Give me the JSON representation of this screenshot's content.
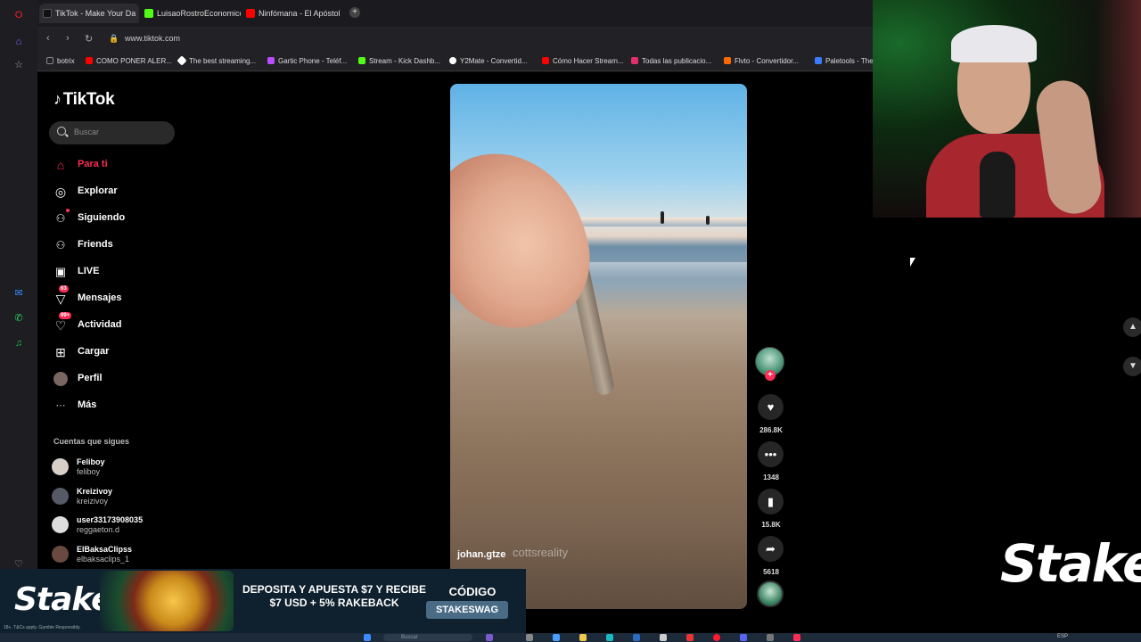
{
  "browser": {
    "tabs": [
      {
        "label": "TikTok - Make Your Da",
        "active": true,
        "color": "#000000"
      },
      {
        "label": "LuisaoRostroEconomico S",
        "active": false,
        "color": "#53fc18"
      },
      {
        "label": "Ninfómana - El Apóstol ft.",
        "active": false,
        "color": "#ff0000"
      }
    ],
    "new_tab_label": "+",
    "url": "www.tiktok.com",
    "bookmarks": [
      {
        "label": "botrix",
        "color": "#777777"
      },
      {
        "label": "COMO PONER ALER...",
        "color": "#ff0000"
      },
      {
        "label": "The best streaming...",
        "color": "#ffffff"
      },
      {
        "label": "Gartic Phone - Teléf...",
        "color": "#b94cff"
      },
      {
        "label": "Stream - Kick Dashb...",
        "color": "#53fc18"
      },
      {
        "label": "Y2Mate - Convertid...",
        "color": "#ffffff"
      },
      {
        "label": "Cómo Hacer Stream...",
        "color": "#ff0000"
      },
      {
        "label": "Todas las publicacio...",
        "color": "#e1306c"
      },
      {
        "label": "Flvto - Convertidor...",
        "color": "#ff6a00"
      },
      {
        "label": "Paletools - The",
        "color": "#3a7bff"
      }
    ]
  },
  "tiktok": {
    "logo": "TikTok",
    "search_placeholder": "Buscar",
    "nav": [
      {
        "label": "Para ti",
        "icon": "home-icon",
        "glyph": "⌂",
        "active": true
      },
      {
        "label": "Explorar",
        "icon": "compass-icon",
        "glyph": "◎"
      },
      {
        "label": "Siguiendo",
        "icon": "following-icon",
        "glyph": "👤"
      },
      {
        "label": "Friends",
        "icon": "friends-icon",
        "glyph": "👥"
      },
      {
        "label": "LIVE",
        "icon": "live-icon",
        "glyph": "▣"
      },
      {
        "label": "Mensajes",
        "icon": "messages-icon",
        "glyph": "▽",
        "badge": "63"
      },
      {
        "label": "Actividad",
        "icon": "activity-icon",
        "glyph": "♡",
        "badge": "99+"
      },
      {
        "label": "Cargar",
        "icon": "upload-icon",
        "glyph": "⊞"
      },
      {
        "label": "Perfil",
        "icon": "profile-icon",
        "glyph": "●"
      },
      {
        "label": "Más",
        "icon": "more-icon",
        "glyph": "···"
      }
    ],
    "following_title": "Cuentas que sigues",
    "following": [
      {
        "name": "Feliboy",
        "handle": "feliboy",
        "color": "#d8d0c8"
      },
      {
        "name": "Kreizivoy",
        "handle": "kreizivoy",
        "color": "#555a66"
      },
      {
        "name": "user33173908035",
        "handle": "reggaeton.d",
        "color": "#dddddd"
      },
      {
        "name": "ElBaksaClipss",
        "handle": "elbaksaclips_1",
        "color": "#6a4a40"
      }
    ],
    "video": {
      "username": "johan.gtze",
      "watermark": "cottsreality"
    },
    "actions": {
      "likes": "286.8K",
      "comments": "1348",
      "saves": "15.8K",
      "shares": "5618"
    }
  },
  "overlay": {
    "stake_logo": "Stake",
    "banner_logo": "Stake",
    "banner_small": "18+. T&Cs apply. Gamble Responsibly.",
    "banner_text": "DEPOSITA Y APUESTA $7 Y RECIBE $7 USD + 5% RAKEBACK",
    "code_label": "CÓDIGO",
    "code_value": "STAKESWAG"
  },
  "taskbar": {
    "search_placeholder": "Buscar",
    "language": "ESP"
  }
}
